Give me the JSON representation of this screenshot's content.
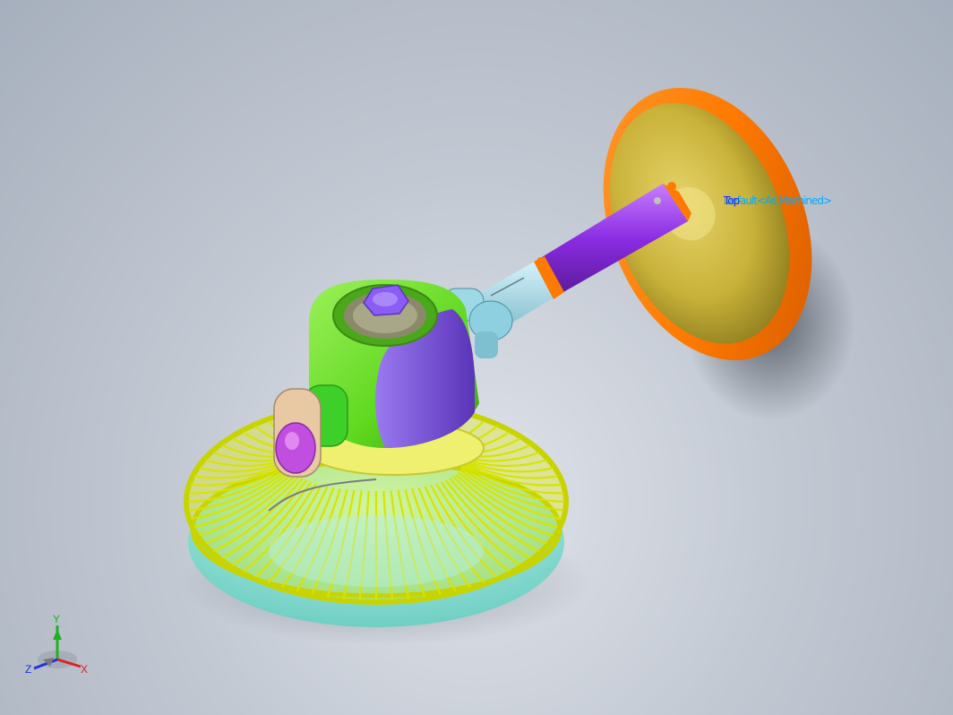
{
  "viewport": {
    "background_top": "#a6afbd",
    "background_bottom": "#dfe3ea"
  },
  "model": {
    "colors": {
      "base_disc_rim": "#ff7a00",
      "base_disc_face": "#c9b23a",
      "pole": "#8a2be2",
      "pole_sleeve": "#9fd8e6",
      "head_housing": "#5fd81f",
      "head_cover": "#7a4fd6",
      "control_knob": "#8b5cf6",
      "grille": "#e6f00a",
      "rear_shell": "#8fe3d9",
      "switch_plate": "#e8c9a4",
      "switch_knob": "#c24ee0"
    }
  },
  "annotation": {
    "text_blue": "Top",
    "text_cyan": "Default<As Machined>",
    "colors": {
      "blue": "#1f1fff",
      "cyan": "#00aaff"
    }
  },
  "triad": {
    "x_label": "X",
    "y_label": "Y",
    "z_label": "Z",
    "colors": {
      "x": "#e02020",
      "y": "#20b020",
      "z": "#2030e0"
    }
  }
}
